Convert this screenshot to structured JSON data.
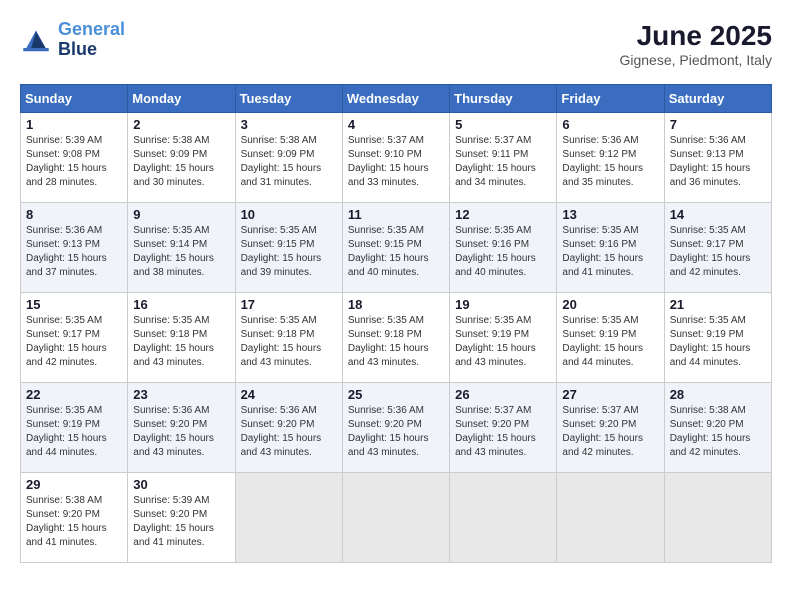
{
  "header": {
    "logo_line1": "General",
    "logo_line2": "Blue",
    "month": "June 2025",
    "location": "Gignese, Piedmont, Italy"
  },
  "weekdays": [
    "Sunday",
    "Monday",
    "Tuesday",
    "Wednesday",
    "Thursday",
    "Friday",
    "Saturday"
  ],
  "weeks": [
    [
      {
        "day": "1",
        "info": "Sunrise: 5:39 AM\nSunset: 9:08 PM\nDaylight: 15 hours\nand 28 minutes."
      },
      {
        "day": "2",
        "info": "Sunrise: 5:38 AM\nSunset: 9:09 PM\nDaylight: 15 hours\nand 30 minutes."
      },
      {
        "day": "3",
        "info": "Sunrise: 5:38 AM\nSunset: 9:09 PM\nDaylight: 15 hours\nand 31 minutes."
      },
      {
        "day": "4",
        "info": "Sunrise: 5:37 AM\nSunset: 9:10 PM\nDaylight: 15 hours\nand 33 minutes."
      },
      {
        "day": "5",
        "info": "Sunrise: 5:37 AM\nSunset: 9:11 PM\nDaylight: 15 hours\nand 34 minutes."
      },
      {
        "day": "6",
        "info": "Sunrise: 5:36 AM\nSunset: 9:12 PM\nDaylight: 15 hours\nand 35 minutes."
      },
      {
        "day": "7",
        "info": "Sunrise: 5:36 AM\nSunset: 9:13 PM\nDaylight: 15 hours\nand 36 minutes."
      }
    ],
    [
      {
        "day": "8",
        "info": "Sunrise: 5:36 AM\nSunset: 9:13 PM\nDaylight: 15 hours\nand 37 minutes."
      },
      {
        "day": "9",
        "info": "Sunrise: 5:35 AM\nSunset: 9:14 PM\nDaylight: 15 hours\nand 38 minutes."
      },
      {
        "day": "10",
        "info": "Sunrise: 5:35 AM\nSunset: 9:15 PM\nDaylight: 15 hours\nand 39 minutes."
      },
      {
        "day": "11",
        "info": "Sunrise: 5:35 AM\nSunset: 9:15 PM\nDaylight: 15 hours\nand 40 minutes."
      },
      {
        "day": "12",
        "info": "Sunrise: 5:35 AM\nSunset: 9:16 PM\nDaylight: 15 hours\nand 40 minutes."
      },
      {
        "day": "13",
        "info": "Sunrise: 5:35 AM\nSunset: 9:16 PM\nDaylight: 15 hours\nand 41 minutes."
      },
      {
        "day": "14",
        "info": "Sunrise: 5:35 AM\nSunset: 9:17 PM\nDaylight: 15 hours\nand 42 minutes."
      }
    ],
    [
      {
        "day": "15",
        "info": "Sunrise: 5:35 AM\nSunset: 9:17 PM\nDaylight: 15 hours\nand 42 minutes."
      },
      {
        "day": "16",
        "info": "Sunrise: 5:35 AM\nSunset: 9:18 PM\nDaylight: 15 hours\nand 43 minutes."
      },
      {
        "day": "17",
        "info": "Sunrise: 5:35 AM\nSunset: 9:18 PM\nDaylight: 15 hours\nand 43 minutes."
      },
      {
        "day": "18",
        "info": "Sunrise: 5:35 AM\nSunset: 9:18 PM\nDaylight: 15 hours\nand 43 minutes."
      },
      {
        "day": "19",
        "info": "Sunrise: 5:35 AM\nSunset: 9:19 PM\nDaylight: 15 hours\nand 43 minutes."
      },
      {
        "day": "20",
        "info": "Sunrise: 5:35 AM\nSunset: 9:19 PM\nDaylight: 15 hours\nand 44 minutes."
      },
      {
        "day": "21",
        "info": "Sunrise: 5:35 AM\nSunset: 9:19 PM\nDaylight: 15 hours\nand 44 minutes."
      }
    ],
    [
      {
        "day": "22",
        "info": "Sunrise: 5:35 AM\nSunset: 9:19 PM\nDaylight: 15 hours\nand 44 minutes."
      },
      {
        "day": "23",
        "info": "Sunrise: 5:36 AM\nSunset: 9:20 PM\nDaylight: 15 hours\nand 43 minutes."
      },
      {
        "day": "24",
        "info": "Sunrise: 5:36 AM\nSunset: 9:20 PM\nDaylight: 15 hours\nand 43 minutes."
      },
      {
        "day": "25",
        "info": "Sunrise: 5:36 AM\nSunset: 9:20 PM\nDaylight: 15 hours\nand 43 minutes."
      },
      {
        "day": "26",
        "info": "Sunrise: 5:37 AM\nSunset: 9:20 PM\nDaylight: 15 hours\nand 43 minutes."
      },
      {
        "day": "27",
        "info": "Sunrise: 5:37 AM\nSunset: 9:20 PM\nDaylight: 15 hours\nand 42 minutes."
      },
      {
        "day": "28",
        "info": "Sunrise: 5:38 AM\nSunset: 9:20 PM\nDaylight: 15 hours\nand 42 minutes."
      }
    ],
    [
      {
        "day": "29",
        "info": "Sunrise: 5:38 AM\nSunset: 9:20 PM\nDaylight: 15 hours\nand 41 minutes."
      },
      {
        "day": "30",
        "info": "Sunrise: 5:39 AM\nSunset: 9:20 PM\nDaylight: 15 hours\nand 41 minutes."
      },
      {
        "day": "",
        "info": ""
      },
      {
        "day": "",
        "info": ""
      },
      {
        "day": "",
        "info": ""
      },
      {
        "day": "",
        "info": ""
      },
      {
        "day": "",
        "info": ""
      }
    ]
  ]
}
